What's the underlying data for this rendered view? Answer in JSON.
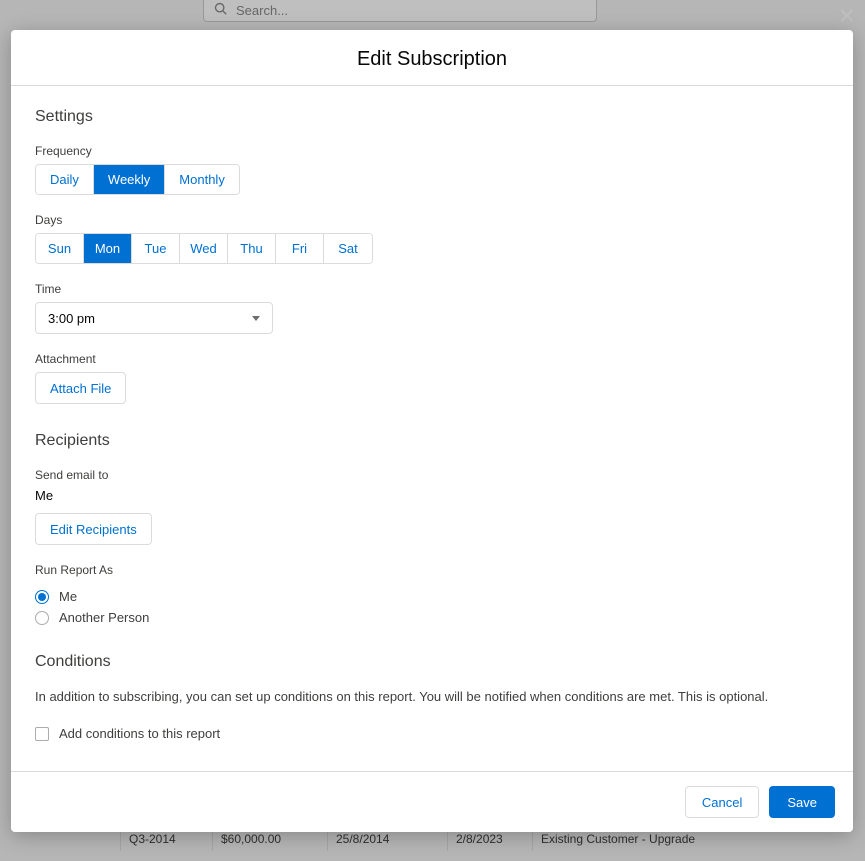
{
  "background": {
    "search_placeholder": "Search...",
    "row": {
      "c1": "Q3-2014",
      "c2": "$60,000.00",
      "c3": "25/8/2014",
      "c4": "2/8/2023",
      "c5": "Existing Customer - Upgrade"
    }
  },
  "modal": {
    "title": "Edit Subscription",
    "settings": {
      "heading": "Settings",
      "frequency": {
        "label": "Frequency",
        "options": [
          "Daily",
          "Weekly",
          "Monthly"
        ],
        "selected": "Weekly"
      },
      "days": {
        "label": "Days",
        "options": [
          "Sun",
          "Mon",
          "Tue",
          "Wed",
          "Thu",
          "Fri",
          "Sat"
        ],
        "selected": "Mon"
      },
      "time": {
        "label": "Time",
        "value": "3:00 pm"
      },
      "attachment": {
        "label": "Attachment",
        "button": "Attach File"
      }
    },
    "recipients": {
      "heading": "Recipients",
      "send_to_label": "Send email to",
      "send_to_value": "Me",
      "edit_button": "Edit Recipients",
      "run_as_label": "Run Report As",
      "run_as_options": {
        "me": "Me",
        "another": "Another Person"
      },
      "run_as_selected": "me"
    },
    "conditions": {
      "heading": "Conditions",
      "help": "In addition to subscribing, you can set up conditions on this report. You will be notified when conditions are met. This is optional.",
      "checkbox_label": "Add conditions to this report",
      "checked": false
    },
    "footer": {
      "cancel": "Cancel",
      "save": "Save"
    }
  }
}
